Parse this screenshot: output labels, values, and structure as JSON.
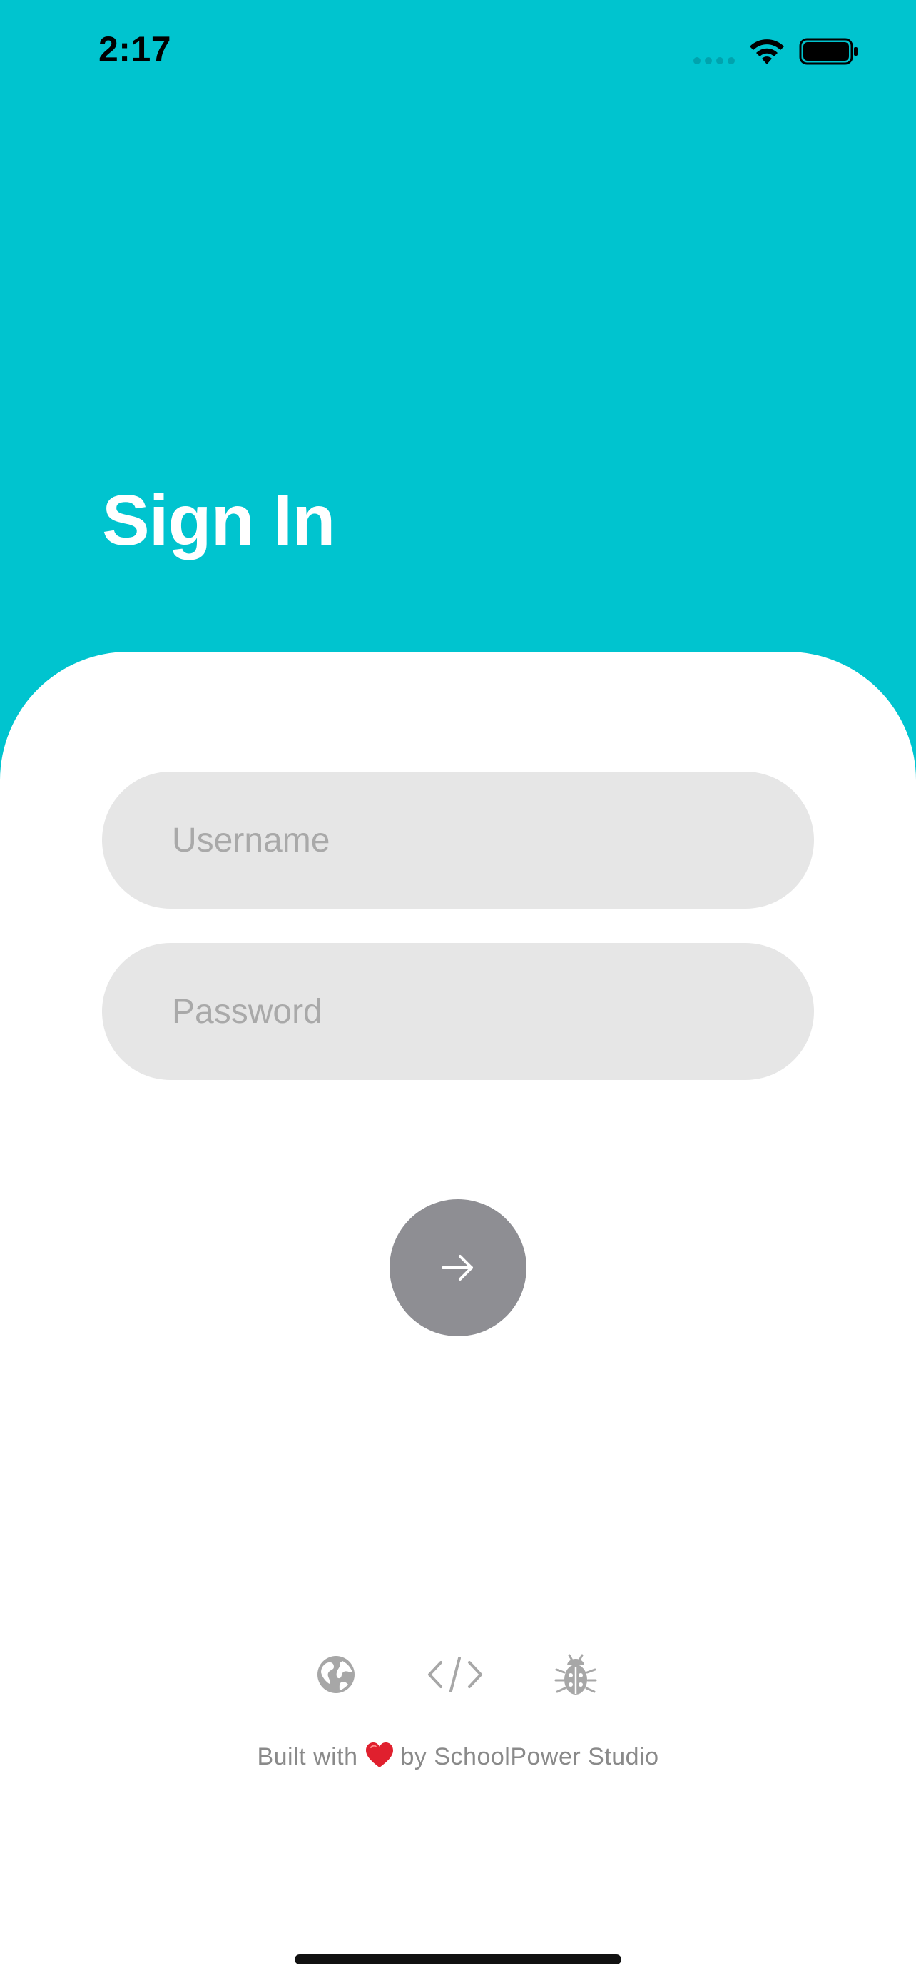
{
  "status_bar": {
    "time": "2:17",
    "icons": [
      "cellular-signal-icon",
      "wifi-icon",
      "battery-icon"
    ]
  },
  "header": {
    "title": "Sign In"
  },
  "form": {
    "username": {
      "placeholder": "Username",
      "value": ""
    },
    "password": {
      "placeholder": "Password",
      "value": ""
    },
    "submit_icon": "arrow-right-icon"
  },
  "footer": {
    "icons": [
      "globe-icon",
      "code-icon",
      "bug-icon"
    ],
    "credit_prefix": "Built with",
    "credit_icon": "heart-icon",
    "credit_suffix": "by SchoolPower Studio"
  },
  "colors": {
    "header_background": "#00C4CF",
    "card_background": "#FFFFFF",
    "input_background": "#E6E6E6",
    "submit_button": "#8E8E93",
    "footer_text": "#8A8A8A",
    "heart": "#E0202E"
  }
}
